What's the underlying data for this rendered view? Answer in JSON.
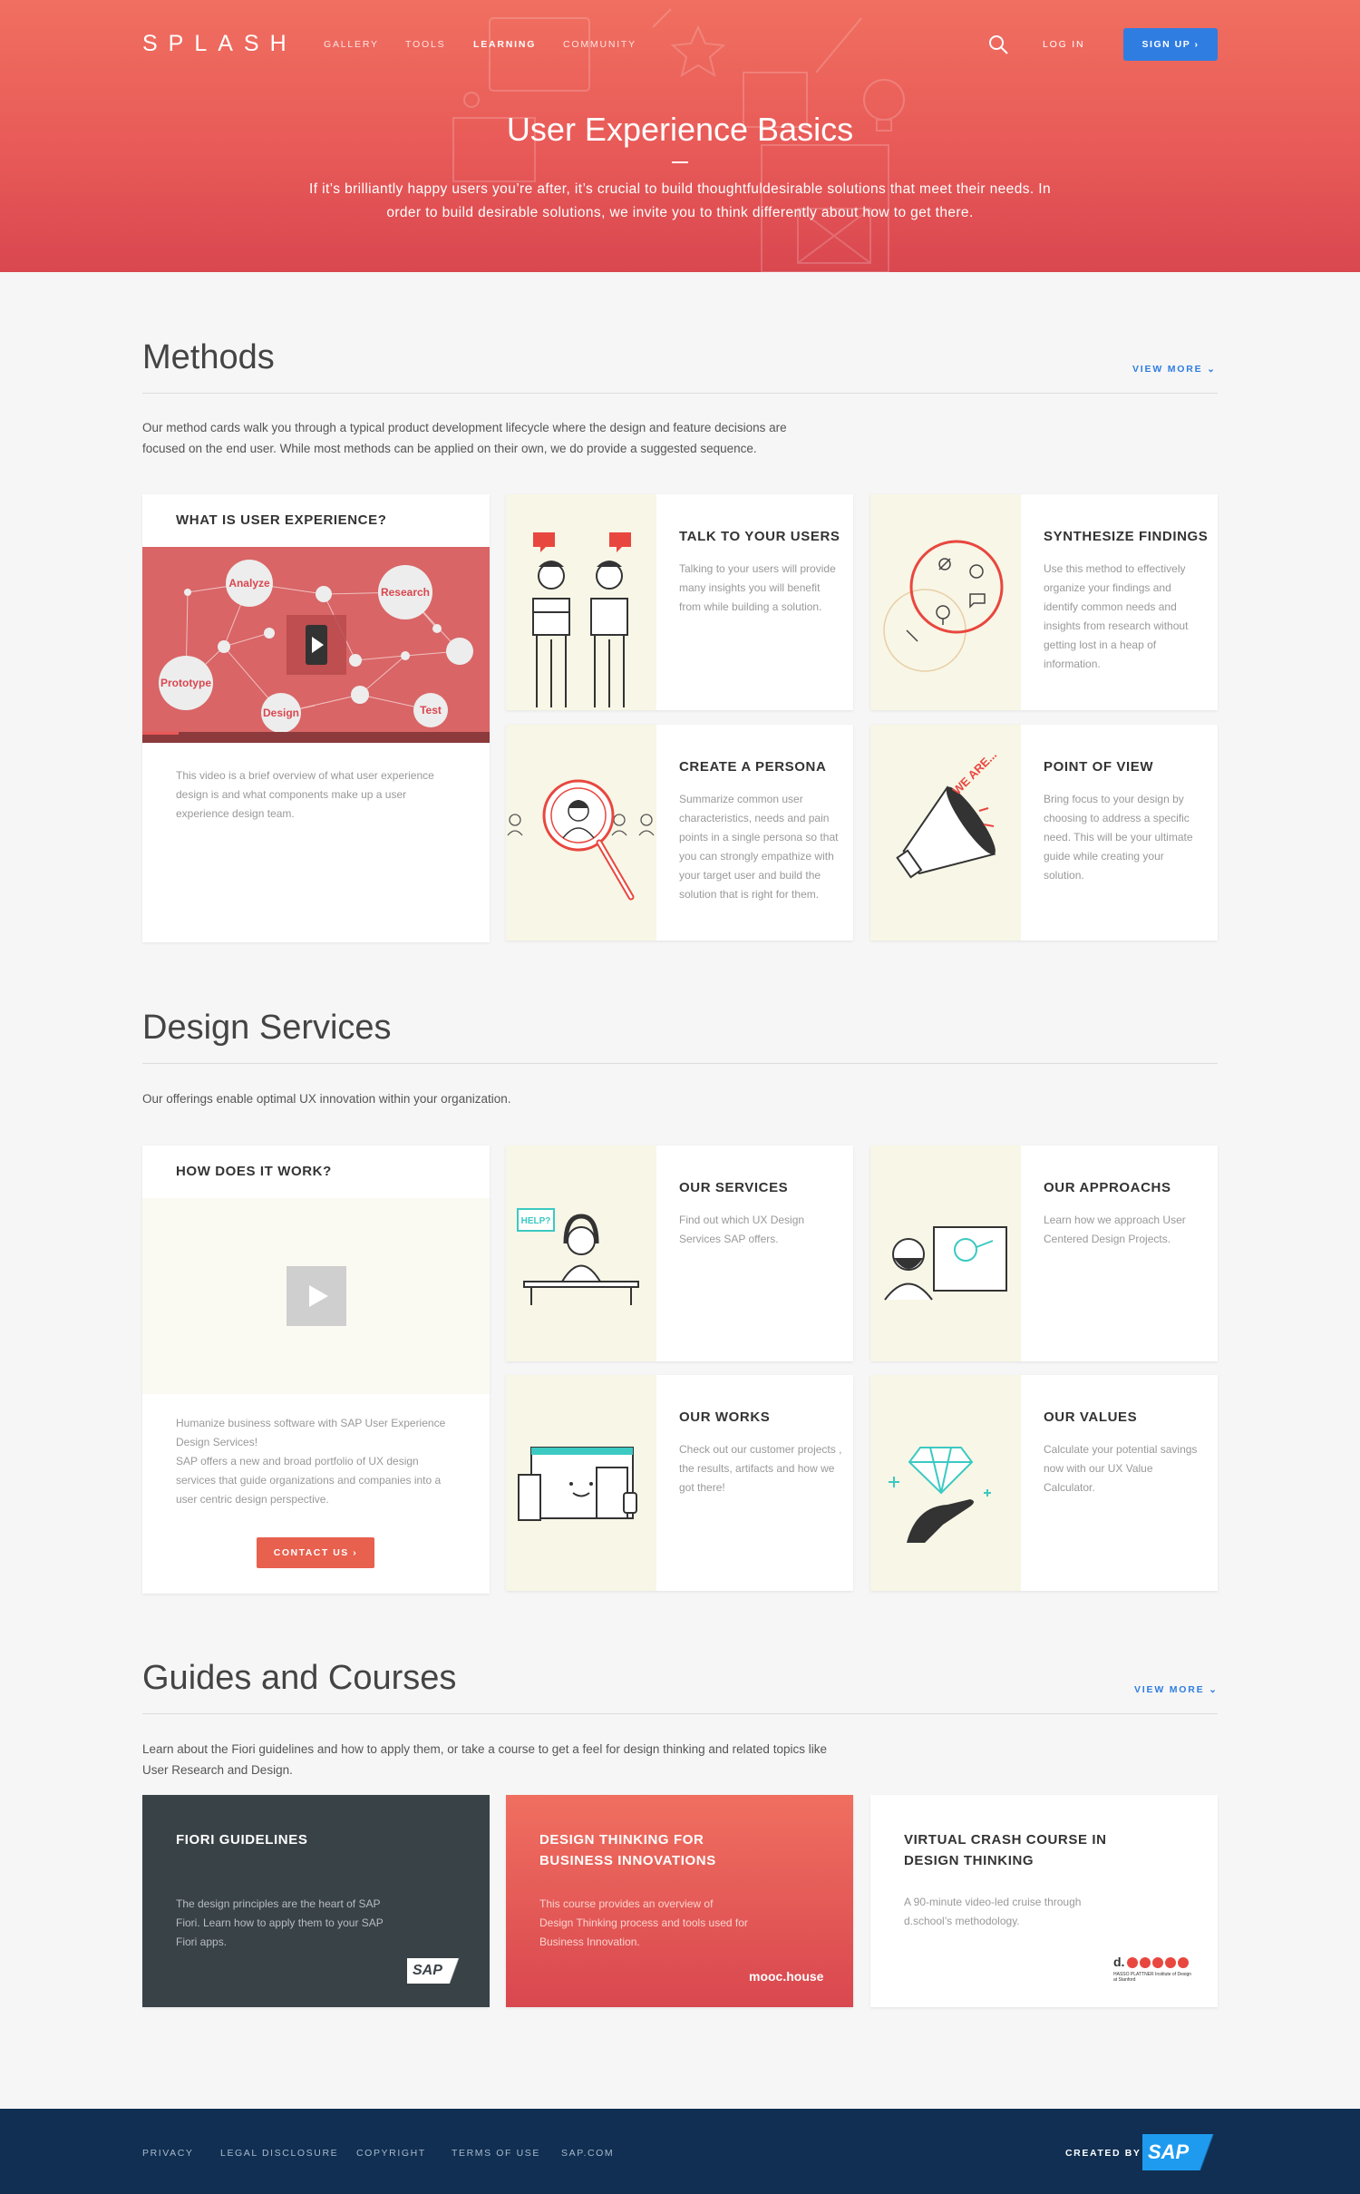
{
  "header": {
    "logo": "SPLASH",
    "nav": [
      "GALLERY",
      "TOOLS",
      "LEARNING",
      "COMMUNITY"
    ],
    "active_nav": "LEARNING",
    "login": "LOG IN",
    "signup": "SIGN UP",
    "title": "User Experience Basics",
    "subtitle": "If it’s brilliantly happy users you’re after, it’s crucial to build thoughtfuldesirable solutions that meet their needs. In order to build desirable solutions, we invite you to think differently about how to get there."
  },
  "methods": {
    "title": "Methods",
    "view_more": "VIEW MORE",
    "description": "Our method cards walk you through a typical product development lifecycle where the design and feature decisions are focused on the end user. While most methods can be applied on their own, we do provide a suggested sequence.",
    "video_card": {
      "title": "WHAT IS USER EXPERIENCE?",
      "nodes": [
        "Analyze",
        "Research",
        "Prototype",
        "Design",
        "Test"
      ],
      "text": "This video is a brief overview of what user experience design is and what components make up a user experience design team."
    },
    "cards": [
      {
        "title": "TALK TO YOUR USERS",
        "text": "Talking to your users will provide many insights you will benefit from while building a solution.",
        "icon": "users-talking-icon"
      },
      {
        "title": "SYNTHESIZE FINDINGS",
        "text": "Use this method to effectively organize your findings and identify common needs and insights from research without getting lost in a heap of information.",
        "icon": "findings-circle-icon"
      },
      {
        "title": "CREATE A PERSONA",
        "text": "Summarize common user characteristics, needs and pain points in a single persona so that you can strongly empathize with your target user and build the solution that is right for them.",
        "icon": "magnifier-persona-icon"
      },
      {
        "title": "POINT OF VIEW",
        "text": "Bring focus to your design by choosing to address a specific need. This will be your ultimate guide while creating your solution.",
        "icon": "megaphone-icon",
        "badge": "WE ARE..."
      }
    ]
  },
  "services": {
    "title": "Design Services",
    "description": "Our offerings enable optimal UX innovation within your organization.",
    "video_card": {
      "title": "HOW DOES IT WORK?",
      "text": "Humanize business software with SAP User Experience Design Services!\nSAP offers a new and broad portfolio of UX design services that guide organizations and companies into a user centric design perspective.",
      "button": "CONTACT US"
    },
    "cards": [
      {
        "title": "OUR SERVICES",
        "text": "Find out which UX Design Services SAP offers.",
        "icon": "helpdesk-icon",
        "badge": "HELP?"
      },
      {
        "title": "OUR APPROACHS",
        "text": "Learn how we approach User Centered Design Projects.",
        "icon": "presenter-icon"
      },
      {
        "title": "OUR WORKS",
        "text": "Check out our customer projects , the results, artifacts and how we got there!",
        "icon": "devices-icon"
      },
      {
        "title": "OUR VALUES",
        "text": "Calculate your potential savings now with our UX Value Calculator.",
        "icon": "diamond-hand-icon"
      }
    ]
  },
  "guides": {
    "title": "Guides and Courses",
    "view_more": "VIEW MORE",
    "description": "Learn about the Fiori guidelines and how to apply them, or take a course to get a feel for design thinking and related topics like User Research and Design.",
    "cards": [
      {
        "title": "FIORI GUIDELINES",
        "text": "The design principles are the heart of SAP Fiori. Learn how to apply them to your SAP Fiori apps.",
        "brand": "SAP",
        "bg": "#394247"
      },
      {
        "title": "DESIGN THINKING FOR BUSINESS INNOVATIONS",
        "text": "This course provides an overview of Design Thinking process and tools used for Business Innovation.",
        "brand": "mooc.house",
        "bg": "#e85a58"
      },
      {
        "title": "VIRTUAL CRASH COURSE IN DESIGN THINKING",
        "text": "A 90-minute video-led cruise through d.school’s methodology.",
        "brand": "d.",
        "brand_sub": "HASSO PLATTNER Institute of Design at Stanford",
        "bg": "#ffffff"
      }
    ]
  },
  "footer": {
    "links": [
      "PRIVACY",
      "LEGAL DISCLOSURE",
      "COPYRIGHT",
      "TERMS OF USE",
      "SAP.COM"
    ],
    "created_by": "CREATED BY",
    "brand": "SAP"
  },
  "colors": {
    "accent_red": "#e85a58",
    "accent_blue": "#2f7de1",
    "footer_navy": "#102f52",
    "illustration_bg": "#f8f6e6"
  }
}
